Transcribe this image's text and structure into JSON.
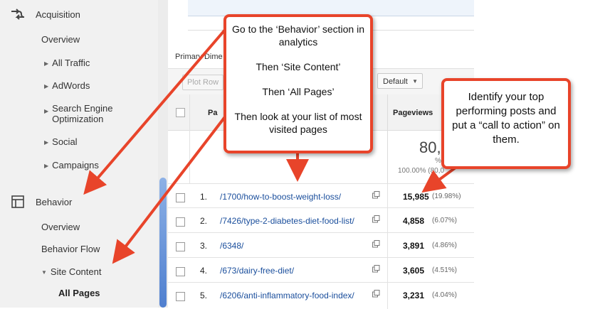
{
  "sidebar": {
    "acquisition": {
      "label": "Acquisition",
      "items": [
        "Overview",
        "All Traffic",
        "AdWords",
        "Search Engine Optimization",
        "Social",
        "Campaigns"
      ]
    },
    "behavior": {
      "label": "Behavior",
      "items": [
        "Overview",
        "Behavior Flow",
        "Site Content"
      ],
      "sub_item": "All Pages"
    }
  },
  "main": {
    "primary_dimension_label": "Primary Dime",
    "plot_rows_label": "Plot Row",
    "default_select": "Default",
    "header": {
      "page_col": "Pa",
      "pageviews_col": "Pageviews"
    },
    "summary": {
      "total": "80,0",
      "of_total": "% of",
      "pct": "100.00% (80,0"
    },
    "rows": [
      {
        "num": "1.",
        "page": "/1700/how-to-boost-weight-loss/",
        "pageviews": "15,985",
        "pct": "(19.98%)"
      },
      {
        "num": "2.",
        "page": "/7426/type-2-diabetes-diet-food-list/",
        "pageviews": "4,858",
        "pct": "(6.07%)"
      },
      {
        "num": "3.",
        "page": "/6348/",
        "pageviews": "3,891",
        "pct": "(4.86%)"
      },
      {
        "num": "4.",
        "page": "/673/dairy-free-diet/",
        "pageviews": "3,605",
        "pct": "(4.51%)"
      },
      {
        "num": "5.",
        "page": "/6206/anti-inflammatory-food-index/",
        "pageviews": "3,231",
        "pct": "(4.04%)"
      }
    ]
  },
  "callouts": {
    "left": [
      "Go to the ‘Behavior’ section in analytics",
      "Then ‘Site Content’",
      "Then ‘All Pages’",
      "Then look at your list of most visited pages"
    ],
    "right": "Identify your top performing posts and put a “call to action” on them."
  },
  "colors": {
    "accent": "#e8442a",
    "link": "#1a4e9c",
    "sidebar_bg": "#f1f1f1"
  }
}
